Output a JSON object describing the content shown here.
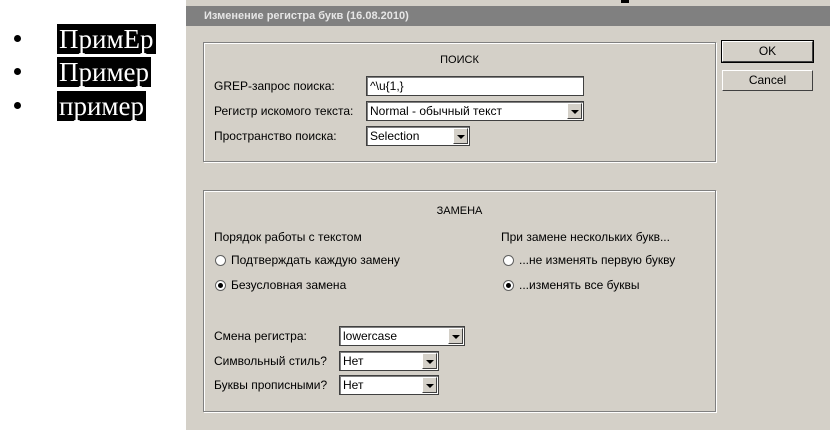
{
  "document": {
    "items": [
      "ПримЕр",
      "Пример",
      "пример"
    ]
  },
  "dialog": {
    "title": "Изменение регистра букв (16.08.2010)",
    "ok_label": "OK",
    "cancel_label": "Cancel",
    "search": {
      "heading": "ПОИСК",
      "grep_label": "GREP-запрос поиска:",
      "grep_value": "^\\u{1,}",
      "case_label": "Регистр искомого текста:",
      "case_value": "Normal - обычный текст",
      "scope_label": "Пространство поиска:",
      "scope_value": "Selection"
    },
    "replace": {
      "heading": "ЗАМЕНА",
      "mode_label": "Порядок работы с текстом",
      "mode_confirm": "Подтверждать каждую замену",
      "mode_unconditional": "Безусловная замена",
      "mode_selected": "unconditional",
      "multi_label": "При замене нескольких букв...",
      "multi_keep_first": "...не изменять первую букву",
      "multi_change_all": "...изменять все буквы",
      "multi_selected": "change_all",
      "case_change_label": "Смена регистра:",
      "case_change_value": "lowercase",
      "char_style_label": "Символьный стиль?",
      "char_style_value": "Нет",
      "caps_label": "Буквы прописными?",
      "caps_value": "Нет"
    }
  }
}
